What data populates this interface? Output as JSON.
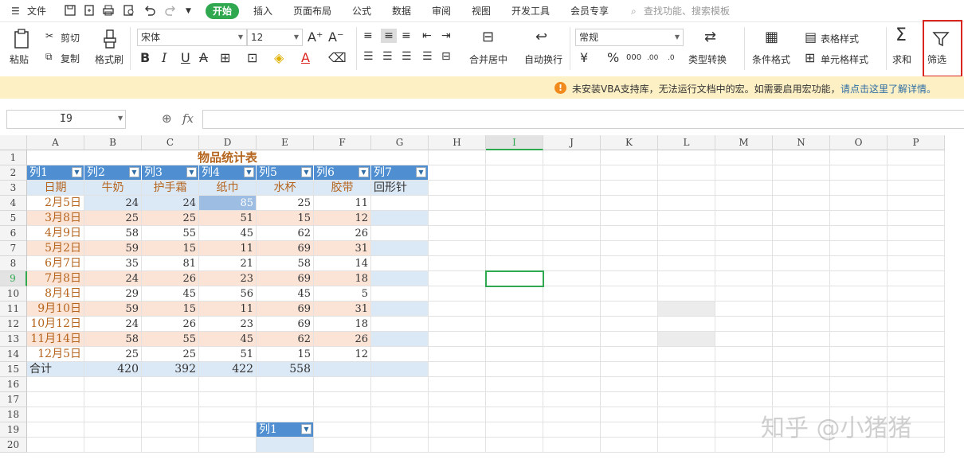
{
  "menubar": {
    "file": "文件",
    "tabs": [
      "开始",
      "插入",
      "页面布局",
      "公式",
      "数据",
      "审阅",
      "视图",
      "开发工具",
      "会员专享"
    ],
    "search": "查找功能、搜索模板"
  },
  "ribbon": {
    "paste": "粘贴",
    "cut": "剪切",
    "copy": "复制",
    "format_painter": "格式刷",
    "font_name": "宋体",
    "font_size": "12",
    "merge_center": "合并居中",
    "wrap_text": "自动换行",
    "number_format": "常规",
    "type_convert": "类型转换",
    "cond_format": "条件格式",
    "table_style": "表格样式",
    "cell_style": "单元格样式",
    "sum": "求和",
    "filter": "筛选"
  },
  "notice": {
    "text": "未安装VBA支持库，无法运行文档中的宏。如需要启用宏功能，",
    "link": "请点击这里了解详情。"
  },
  "formula_bar": {
    "name_box": "I9",
    "fx": "fx",
    "content": ""
  },
  "columns": [
    "A",
    "B",
    "C",
    "D",
    "E",
    "F",
    "G",
    "H",
    "I",
    "J",
    "K",
    "L",
    "M",
    "N",
    "O",
    "P"
  ],
  "rows": [
    "1",
    "2",
    "3",
    "4",
    "5",
    "6",
    "7",
    "8",
    "9",
    "10",
    "11",
    "12",
    "13",
    "14",
    "15",
    "16",
    "17",
    "18",
    "19",
    "20"
  ],
  "sheet": {
    "title": "物品统计表",
    "headers": [
      "列1",
      "列2",
      "列3",
      "列4",
      "列5",
      "列6",
      "列7"
    ],
    "subheaders": [
      "日期",
      "牛奶",
      "护手霜",
      "纸巾",
      "水杯",
      "胶带",
      "回形针"
    ],
    "data": [
      [
        "2月5日",
        "24",
        "24",
        "85",
        "25",
        "11",
        ""
      ],
      [
        "3月8日",
        "25",
        "25",
        "51",
        "15",
        "12",
        ""
      ],
      [
        "4月9日",
        "58",
        "55",
        "45",
        "62",
        "26",
        ""
      ],
      [
        "5月2日",
        "59",
        "15",
        "11",
        "69",
        "31",
        ""
      ],
      [
        "6月7日",
        "35",
        "81",
        "21",
        "58",
        "14",
        ""
      ],
      [
        "7月8日",
        "24",
        "26",
        "23",
        "69",
        "18",
        ""
      ],
      [
        "8月4日",
        "29",
        "45",
        "56",
        "45",
        "5",
        ""
      ],
      [
        "9月10日",
        "59",
        "15",
        "11",
        "69",
        "31",
        ""
      ],
      [
        "10月12日",
        "24",
        "26",
        "23",
        "69",
        "18",
        ""
      ],
      [
        "11月14日",
        "58",
        "55",
        "45",
        "62",
        "26",
        ""
      ],
      [
        "12月5日",
        "25",
        "25",
        "51",
        "15",
        "12",
        ""
      ]
    ],
    "total": [
      "合计",
      "420",
      "392",
      "422",
      "558",
      "",
      ""
    ],
    "small_table_header": "列1"
  },
  "watermark": "知乎 @小猪猪",
  "colors": {
    "accent": "#2fa84f",
    "table_header": "#4f8fd1",
    "band_peach": "#fbe3d6",
    "band_blue": "#dbe8f6",
    "text_orange": "#b5651d",
    "highlight_red": "#d9251d"
  }
}
